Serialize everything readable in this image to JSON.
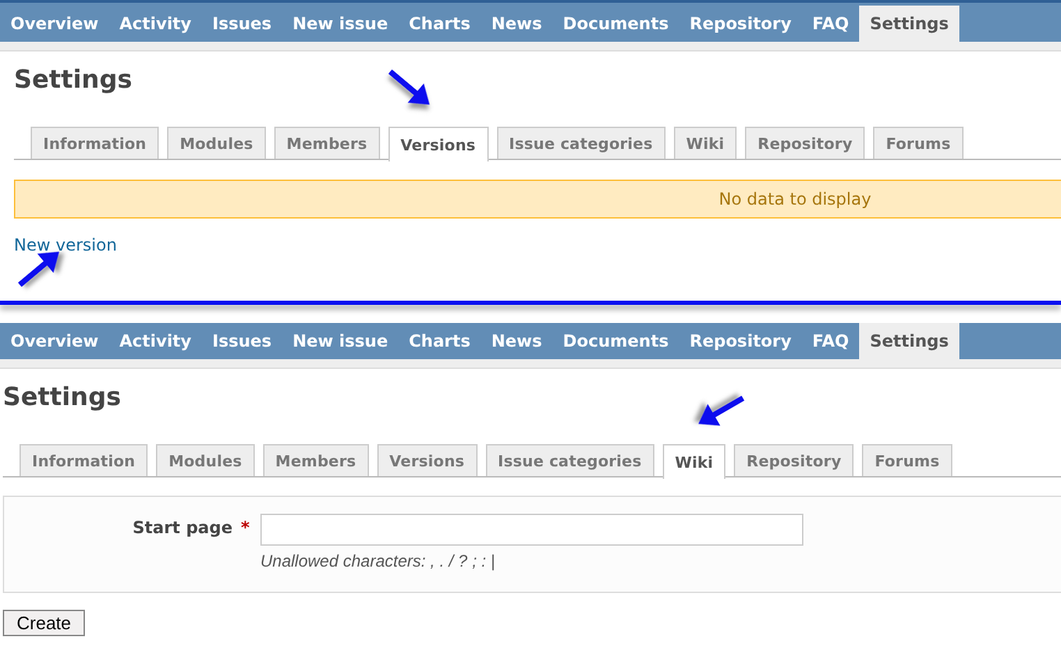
{
  "panels": [
    {
      "menu": [
        {
          "label": "Overview",
          "selected": false
        },
        {
          "label": "Activity",
          "selected": false
        },
        {
          "label": "Issues",
          "selected": false
        },
        {
          "label": "New issue",
          "selected": false
        },
        {
          "label": "Charts",
          "selected": false
        },
        {
          "label": "News",
          "selected": false
        },
        {
          "label": "Documents",
          "selected": false
        },
        {
          "label": "Repository",
          "selected": false
        },
        {
          "label": "FAQ",
          "selected": false
        },
        {
          "label": "Settings",
          "selected": true
        }
      ],
      "heading": "Settings",
      "tabs": [
        {
          "label": "Information",
          "selected": false
        },
        {
          "label": "Modules",
          "selected": false
        },
        {
          "label": "Members",
          "selected": false
        },
        {
          "label": "Versions",
          "selected": true
        },
        {
          "label": "Issue categories",
          "selected": false
        },
        {
          "label": "Wiki",
          "selected": false
        },
        {
          "label": "Repository",
          "selected": false
        },
        {
          "label": "Forums",
          "selected": false
        }
      ],
      "content": {
        "kind": "versions",
        "flash": "No data to display",
        "link": "New version"
      }
    },
    {
      "menu": [
        {
          "label": "Overview",
          "selected": false
        },
        {
          "label": "Activity",
          "selected": false
        },
        {
          "label": "Issues",
          "selected": false
        },
        {
          "label": "New issue",
          "selected": false
        },
        {
          "label": "Charts",
          "selected": false
        },
        {
          "label": "News",
          "selected": false
        },
        {
          "label": "Documents",
          "selected": false
        },
        {
          "label": "Repository",
          "selected": false
        },
        {
          "label": "FAQ",
          "selected": false
        },
        {
          "label": "Settings",
          "selected": true
        }
      ],
      "heading": "Settings",
      "tabs": [
        {
          "label": "Information",
          "selected": false
        },
        {
          "label": "Modules",
          "selected": false
        },
        {
          "label": "Members",
          "selected": false
        },
        {
          "label": "Versions",
          "selected": false
        },
        {
          "label": "Issue categories",
          "selected": false
        },
        {
          "label": "Wiki",
          "selected": true
        },
        {
          "label": "Repository",
          "selected": false
        },
        {
          "label": "Forums",
          "selected": false
        }
      ],
      "content": {
        "kind": "wiki",
        "field_label": "Start page",
        "required_mark": "*",
        "hint": "Unallowed characters: , . / ? ; : |",
        "button": "Create"
      }
    }
  ]
}
